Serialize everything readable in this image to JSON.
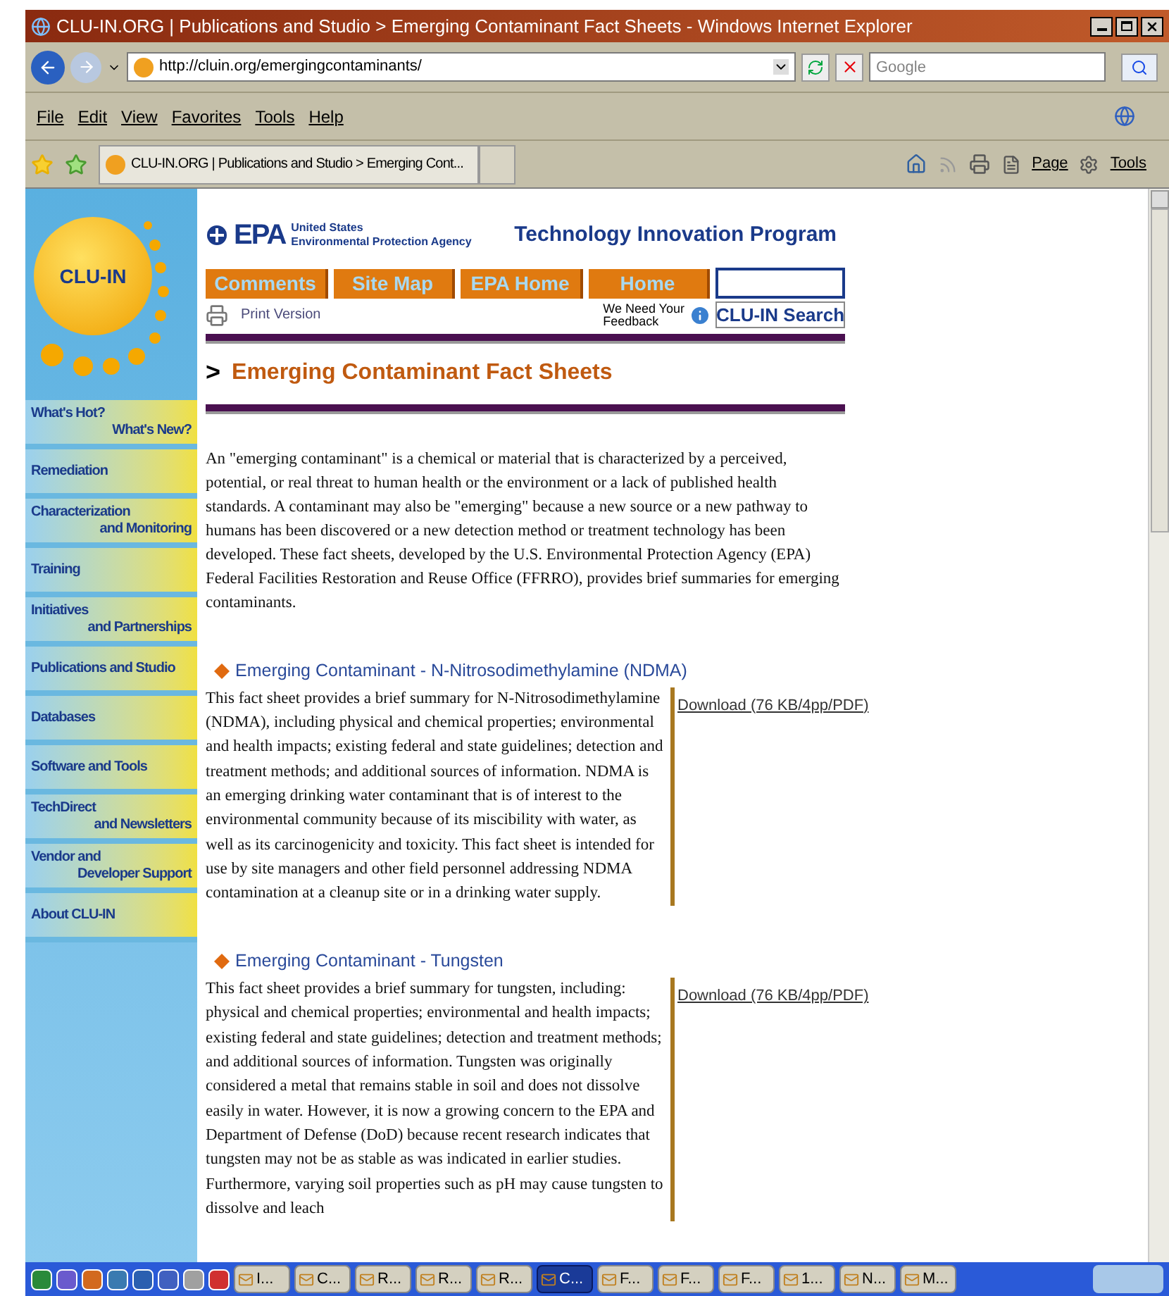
{
  "window": {
    "title": "CLU-IN.ORG | Publications and Studio > Emerging Contaminant Fact Sheets - Windows Internet Explorer"
  },
  "address_bar": {
    "url": "http://cluin.org/emergingcontaminants/"
  },
  "search": {
    "placeholder": "Google"
  },
  "menu": [
    "File",
    "Edit",
    "View",
    "Favorites",
    "Tools",
    "Help"
  ],
  "tab": {
    "title": "CLU-IN.ORG | Publications and Studio > Emerging Cont..."
  },
  "command_bar": [
    "Page",
    "Tools"
  ],
  "page": {
    "logo": "CLU-IN",
    "agency": [
      "United States",
      "Environmental Protection Agency"
    ],
    "epa": "EPA",
    "program": "Technology Innovation Program",
    "nav": [
      "Comments",
      "Site Map",
      "EPA Home",
      "Home"
    ],
    "print": "Print Version",
    "feedback": [
      "We Need Your",
      "Feedback"
    ],
    "search_button": "CLU-IN Search",
    "heading_mark": ">",
    "heading": "Emerging Contaminant Fact Sheets",
    "intro": "An \"emerging contaminant\" is a chemical or material that is characterized by a perceived, potential, or real threat to human health or the environment or a lack of published health standards. A contaminant may also be \"emerging\" because a new source or a new pathway to humans has been discovered or a new detection method or treatment technology has been developed. These fact sheets, developed by the U.S. Environmental Protection Agency (EPA) Federal Facilities Restoration and Reuse Office (FFRRO), provides brief summaries for emerging contaminants.",
    "sheets": [
      {
        "title": "Emerging Contaminant - N-Nitrosodimethylamine (NDMA)",
        "text": "This fact sheet provides a brief summary for N-Nitrosodimethylamine (NDMA), including physical and chemical properties; environmental and health impacts; existing federal and state guidelines; detection and treatment methods; and additional sources of information. NDMA is an emerging drinking water contaminant that is of interest to the environmental community because of its miscibility with water, as well as its carcinogenicity and toxicity. This fact sheet is intended for use by site managers and other field personnel addressing NDMA contamination at a cleanup site or in a drinking water supply.",
        "download": "Download (76 KB/4pp/PDF)"
      },
      {
        "title": "Emerging Contaminant - Tungsten",
        "text": "This fact sheet provides a brief summary for tungsten, including: physical and chemical properties; environmental and health impacts; existing federal and state guidelines; detection and treatment methods; and additional sources of information. Tungsten was originally considered a metal that remains stable in soil and does not dissolve easily in water. However, it is now a growing concern to the EPA and Department of Defense (DoD) because recent research indicates that tungsten may not be as stable as was indicated in earlier studies. Furthermore, varying soil properties such as pH may cause tungsten to dissolve and leach",
        "download": "Download (76 KB/4pp/PDF)"
      }
    ]
  },
  "sidebar": {
    "items": [
      {
        "lines": [
          "What's Hot?",
          "What's New?"
        ]
      },
      {
        "lines": [
          "Remediation"
        ]
      },
      {
        "lines": [
          "Characterization",
          "and Monitoring"
        ]
      },
      {
        "lines": [
          "Training"
        ]
      },
      {
        "lines": [
          "Initiatives",
          "and Partnerships"
        ]
      },
      {
        "lines": [
          "Publications and Studio"
        ]
      },
      {
        "lines": [
          "Databases"
        ]
      },
      {
        "lines": [
          "Software and Tools"
        ]
      },
      {
        "lines": [
          "TechDirect",
          "and Newsletters"
        ]
      },
      {
        "lines": [
          "Vendor and",
          "Developer Support"
        ]
      },
      {
        "lines": [
          "About CLU-IN"
        ]
      }
    ]
  },
  "taskbar": {
    "buttons": [
      {
        "label": "I...",
        "selected": false
      },
      {
        "label": "C...",
        "selected": false
      },
      {
        "label": "R...",
        "selected": false
      },
      {
        "label": "R...",
        "selected": false
      },
      {
        "label": "R...",
        "selected": false
      },
      {
        "label": "C...",
        "selected": true
      },
      {
        "label": "F...",
        "selected": false
      },
      {
        "label": "F...",
        "selected": false
      },
      {
        "label": "F...",
        "selected": false
      },
      {
        "label": "1...",
        "selected": false
      },
      {
        "label": "N...",
        "selected": false
      },
      {
        "label": "M...",
        "selected": false
      }
    ]
  }
}
